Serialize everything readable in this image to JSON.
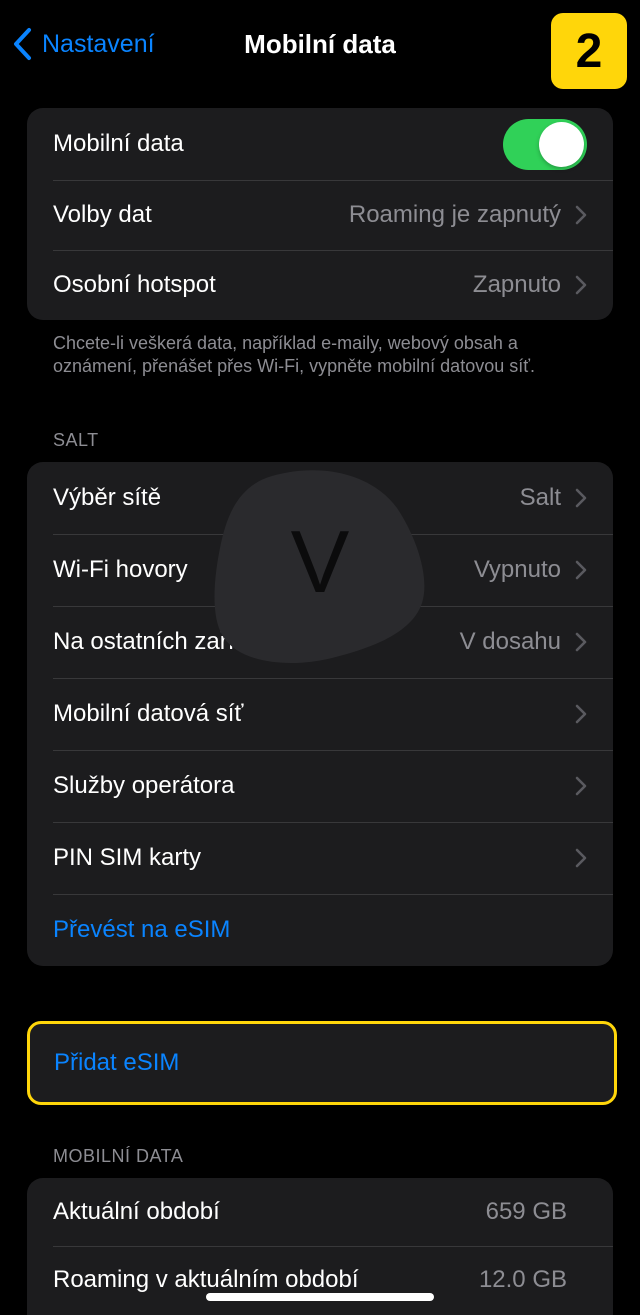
{
  "nav": {
    "back_label": "Nastavení",
    "title": "Mobilní data"
  },
  "step_badge": "2",
  "main_group": {
    "mobile_data_label": "Mobilní data",
    "mobile_data_on": true,
    "data_options_label": "Volby dat",
    "data_options_value": "Roaming je zapnutý",
    "hotspot_label": "Osobní hotspot",
    "hotspot_value": "Zapnuto"
  },
  "footnote": "Chcete-li veškerá data, například e-maily, webový obsah a oznámení, přenášet přes Wi-Fi, vypněte mobilní datovou síť.",
  "carrier_section": {
    "header": "SALT",
    "network_label": "Výběr sítě",
    "network_value": "Salt",
    "wifi_calling_label": "Wi-Fi hovory",
    "wifi_calling_value": "Vypnuto",
    "other_devices_label": "Na ostatních zařízeních",
    "other_devices_value": "V dosahu",
    "cellular_network_label": "Mobilní datová síť",
    "carrier_services_label": "Služby operátora",
    "sim_pin_label": "PIN SIM karty",
    "convert_esim_label": "Převést na eSIM"
  },
  "watermark_letter": "V",
  "add_esim_label": "Přidat eSIM",
  "usage_section": {
    "header": "MOBILNÍ DATA",
    "current_period_label": "Aktuální období",
    "current_period_value": "659 GB",
    "roaming_period_label": "Roaming v aktuálním období",
    "roaming_period_value": "12.0 GB"
  },
  "colors": {
    "accent": "#0a84ff",
    "toggle_on": "#30d158",
    "highlight": "#ffd60a",
    "group_bg": "#1c1c1e",
    "secondary_text": "#8d8d93"
  }
}
